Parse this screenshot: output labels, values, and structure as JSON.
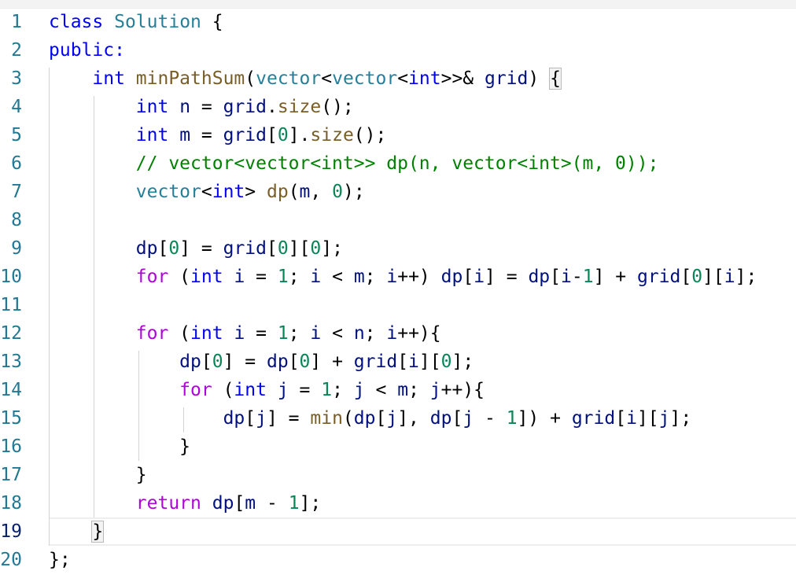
{
  "editor": {
    "line_numbers": [
      "1",
      "2",
      "3",
      "4",
      "5",
      "6",
      "7",
      "8",
      "9",
      "10",
      "11",
      "12",
      "13",
      "14",
      "15",
      "16",
      "17",
      "18",
      "19",
      "20"
    ],
    "active_line": "19",
    "lines": [
      [
        {
          "t": "class",
          "c": "kw"
        },
        {
          "t": " "
        },
        {
          "t": "Solution",
          "c": "typ"
        },
        {
          "t": " {"
        }
      ],
      [
        {
          "t": "public:",
          "c": "kw"
        }
      ],
      [
        {
          "t": "    "
        },
        {
          "t": "int",
          "c": "kw"
        },
        {
          "t": " "
        },
        {
          "t": "minPathSum",
          "c": "fn"
        },
        {
          "t": "("
        },
        {
          "t": "vector",
          "c": "typ"
        },
        {
          "t": "<"
        },
        {
          "t": "vector",
          "c": "typ"
        },
        {
          "t": "<"
        },
        {
          "t": "int",
          "c": "kw"
        },
        {
          "t": ">>& "
        },
        {
          "t": "grid",
          "c": "var"
        },
        {
          "t": ") "
        },
        {
          "t": "{",
          "b": true
        }
      ],
      [
        {
          "t": "        "
        },
        {
          "t": "int",
          "c": "kw"
        },
        {
          "t": " "
        },
        {
          "t": "n",
          "c": "var"
        },
        {
          "t": " = "
        },
        {
          "t": "grid",
          "c": "var"
        },
        {
          "t": "."
        },
        {
          "t": "size",
          "c": "fn"
        },
        {
          "t": "();"
        }
      ],
      [
        {
          "t": "        "
        },
        {
          "t": "int",
          "c": "kw"
        },
        {
          "t": " "
        },
        {
          "t": "m",
          "c": "var"
        },
        {
          "t": " = "
        },
        {
          "t": "grid",
          "c": "var"
        },
        {
          "t": "["
        },
        {
          "t": "0",
          "c": "num"
        },
        {
          "t": "]."
        },
        {
          "t": "size",
          "c": "fn"
        },
        {
          "t": "();"
        }
      ],
      [
        {
          "t": "        "
        },
        {
          "t": "// vector<vector<int>> dp(n, vector<int>(m, 0));",
          "c": "cmt"
        }
      ],
      [
        {
          "t": "        "
        },
        {
          "t": "vector",
          "c": "typ"
        },
        {
          "t": "<"
        },
        {
          "t": "int",
          "c": "kw"
        },
        {
          "t": "> "
        },
        {
          "t": "dp",
          "c": "fn"
        },
        {
          "t": "("
        },
        {
          "t": "m",
          "c": "var"
        },
        {
          "t": ", "
        },
        {
          "t": "0",
          "c": "num"
        },
        {
          "t": ");"
        }
      ],
      [],
      [
        {
          "t": "        "
        },
        {
          "t": "dp",
          "c": "var"
        },
        {
          "t": "["
        },
        {
          "t": "0",
          "c": "num"
        },
        {
          "t": "] = "
        },
        {
          "t": "grid",
          "c": "var"
        },
        {
          "t": "["
        },
        {
          "t": "0",
          "c": "num"
        },
        {
          "t": "]["
        },
        {
          "t": "0",
          "c": "num"
        },
        {
          "t": "];"
        }
      ],
      [
        {
          "t": "        "
        },
        {
          "t": "for",
          "c": "ctl"
        },
        {
          "t": " ("
        },
        {
          "t": "int",
          "c": "kw"
        },
        {
          "t": " "
        },
        {
          "t": "i",
          "c": "var"
        },
        {
          "t": " = "
        },
        {
          "t": "1",
          "c": "num"
        },
        {
          "t": "; "
        },
        {
          "t": "i",
          "c": "var"
        },
        {
          "t": " < "
        },
        {
          "t": "m",
          "c": "var"
        },
        {
          "t": "; "
        },
        {
          "t": "i",
          "c": "var"
        },
        {
          "t": "++) "
        },
        {
          "t": "dp",
          "c": "var"
        },
        {
          "t": "["
        },
        {
          "t": "i",
          "c": "var"
        },
        {
          "t": "] = "
        },
        {
          "t": "dp",
          "c": "var"
        },
        {
          "t": "["
        },
        {
          "t": "i",
          "c": "var"
        },
        {
          "t": "-"
        },
        {
          "t": "1",
          "c": "num"
        },
        {
          "t": "] + "
        },
        {
          "t": "grid",
          "c": "var"
        },
        {
          "t": "["
        },
        {
          "t": "0",
          "c": "num"
        },
        {
          "t": "]["
        },
        {
          "t": "i",
          "c": "var"
        },
        {
          "t": "];"
        }
      ],
      [],
      [
        {
          "t": "        "
        },
        {
          "t": "for",
          "c": "ctl"
        },
        {
          "t": " ("
        },
        {
          "t": "int",
          "c": "kw"
        },
        {
          "t": " "
        },
        {
          "t": "i",
          "c": "var"
        },
        {
          "t": " = "
        },
        {
          "t": "1",
          "c": "num"
        },
        {
          "t": "; "
        },
        {
          "t": "i",
          "c": "var"
        },
        {
          "t": " < "
        },
        {
          "t": "n",
          "c": "var"
        },
        {
          "t": "; "
        },
        {
          "t": "i",
          "c": "var"
        },
        {
          "t": "++){"
        }
      ],
      [
        {
          "t": "            "
        },
        {
          "t": "dp",
          "c": "var"
        },
        {
          "t": "["
        },
        {
          "t": "0",
          "c": "num"
        },
        {
          "t": "] = "
        },
        {
          "t": "dp",
          "c": "var"
        },
        {
          "t": "["
        },
        {
          "t": "0",
          "c": "num"
        },
        {
          "t": "] + "
        },
        {
          "t": "grid",
          "c": "var"
        },
        {
          "t": "["
        },
        {
          "t": "i",
          "c": "var"
        },
        {
          "t": "]["
        },
        {
          "t": "0",
          "c": "num"
        },
        {
          "t": "];"
        }
      ],
      [
        {
          "t": "            "
        },
        {
          "t": "for",
          "c": "ctl"
        },
        {
          "t": " ("
        },
        {
          "t": "int",
          "c": "kw"
        },
        {
          "t": " "
        },
        {
          "t": "j",
          "c": "var"
        },
        {
          "t": " = "
        },
        {
          "t": "1",
          "c": "num"
        },
        {
          "t": "; "
        },
        {
          "t": "j",
          "c": "var"
        },
        {
          "t": " < "
        },
        {
          "t": "m",
          "c": "var"
        },
        {
          "t": "; "
        },
        {
          "t": "j",
          "c": "var"
        },
        {
          "t": "++){"
        }
      ],
      [
        {
          "t": "                "
        },
        {
          "t": "dp",
          "c": "var"
        },
        {
          "t": "["
        },
        {
          "t": "j",
          "c": "var"
        },
        {
          "t": "] = "
        },
        {
          "t": "min",
          "c": "fn"
        },
        {
          "t": "("
        },
        {
          "t": "dp",
          "c": "var"
        },
        {
          "t": "["
        },
        {
          "t": "j",
          "c": "var"
        },
        {
          "t": "], "
        },
        {
          "t": "dp",
          "c": "var"
        },
        {
          "t": "["
        },
        {
          "t": "j",
          "c": "var"
        },
        {
          "t": " - "
        },
        {
          "t": "1",
          "c": "num"
        },
        {
          "t": "]) + "
        },
        {
          "t": "grid",
          "c": "var"
        },
        {
          "t": "["
        },
        {
          "t": "i",
          "c": "var"
        },
        {
          "t": "]["
        },
        {
          "t": "j",
          "c": "var"
        },
        {
          "t": "];"
        }
      ],
      [
        {
          "t": "            }"
        }
      ],
      [
        {
          "t": "        }"
        }
      ],
      [
        {
          "t": "        "
        },
        {
          "t": "return",
          "c": "ctl"
        },
        {
          "t": " "
        },
        {
          "t": "dp",
          "c": "var"
        },
        {
          "t": "["
        },
        {
          "t": "m",
          "c": "var"
        },
        {
          "t": " - "
        },
        {
          "t": "1",
          "c": "num"
        },
        {
          "t": "];"
        }
      ],
      [
        {
          "t": "    "
        },
        {
          "t": "}",
          "b": true
        }
      ],
      [
        {
          "t": "};"
        }
      ]
    ]
  },
  "colors": {
    "keyword": "#0000ff",
    "control": "#af00db",
    "type": "#267f99",
    "function": "#795e26",
    "variable": "#001080",
    "number": "#098658",
    "comment": "#008000",
    "line_number": "#237893",
    "active_line_number": "#0b216f"
  }
}
